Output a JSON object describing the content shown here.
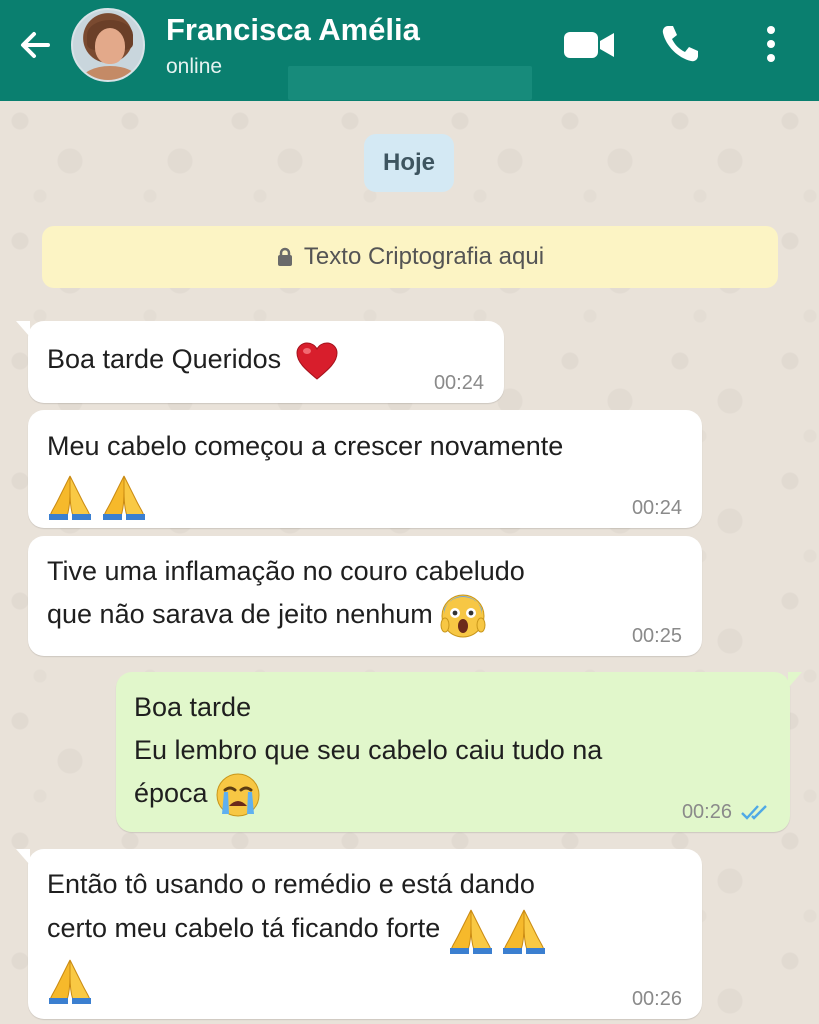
{
  "header": {
    "contact_name": "Francisca Amélia",
    "status": "online",
    "color": "#0a7f6f",
    "icons": [
      "back-arrow-icon",
      "video-call-icon",
      "phone-icon",
      "more-vertical-icon"
    ]
  },
  "chat": {
    "date_label": "Hoje",
    "encryption_notice": "Texto Criptografia aqui",
    "messages": [
      {
        "direction": "in",
        "text": "Boa tarde Queridos",
        "emoji": [
          "red-heart"
        ],
        "time": "00:24"
      },
      {
        "direction": "in",
        "text": "Meu cabelo começou a crescer novamente",
        "emoji": [
          "folded-hands",
          "folded-hands"
        ],
        "time": "00:24"
      },
      {
        "direction": "in",
        "text": "Tive uma inflamação no couro cabeludo\nque não sarava de jeito nenhum",
        "emoji": [
          "screaming-face"
        ],
        "time": "00:25"
      },
      {
        "direction": "out",
        "text": "Boa tarde\nEu lembro que seu cabelo caiu tudo na\népoca",
        "emoji": [
          "crying-face"
        ],
        "time": "00:26",
        "read": true
      },
      {
        "direction": "in",
        "text": "Então tô usando o remédio e está dando\ncerto meu cabelo tá ficando forte",
        "emoji": [
          "folded-hands",
          "folded-hands",
          "folded-hands"
        ],
        "time": "00:26"
      }
    ]
  },
  "colors": {
    "incoming_bubble": "#ffffff",
    "outgoing_bubble": "#e1f7cb",
    "read_ticks": "#4fa9e6",
    "date_chip": "#d4e9f4",
    "encryption_bg": "#fcf4c4"
  }
}
